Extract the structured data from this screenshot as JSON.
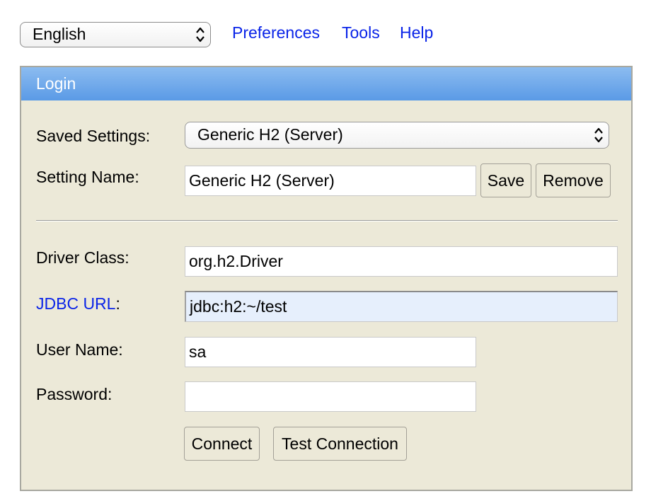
{
  "topbar": {
    "language": "English",
    "links": {
      "preferences": "Preferences",
      "tools": "Tools",
      "help": "Help"
    }
  },
  "login": {
    "title": "Login",
    "saved_settings": {
      "label": "Saved Settings:",
      "value": "Generic H2 (Server)"
    },
    "setting_name": {
      "label": "Setting Name:",
      "value": "Generic H2 (Server)",
      "save_label": "Save",
      "remove_label": "Remove"
    },
    "driver_class": {
      "label": "Driver Class:",
      "value": "org.h2.Driver"
    },
    "jdbc_url": {
      "link_label": "JDBC URL",
      "suffix": ":",
      "value": "jdbc:h2:~/test"
    },
    "user_name": {
      "label": "User Name:",
      "value": "sa"
    },
    "password": {
      "label": "Password:",
      "value": ""
    },
    "connect_label": "Connect",
    "test_connection_label": "Test Connection"
  },
  "colors": {
    "link": "#0a24e8",
    "panel_bg": "#ece9d8",
    "header_top": "#8cbcf0",
    "header_bottom": "#5a9ae6",
    "focused_field_bg": "#e6effc"
  },
  "icons": {
    "select_arrows": "up-down-chevron-icon"
  }
}
